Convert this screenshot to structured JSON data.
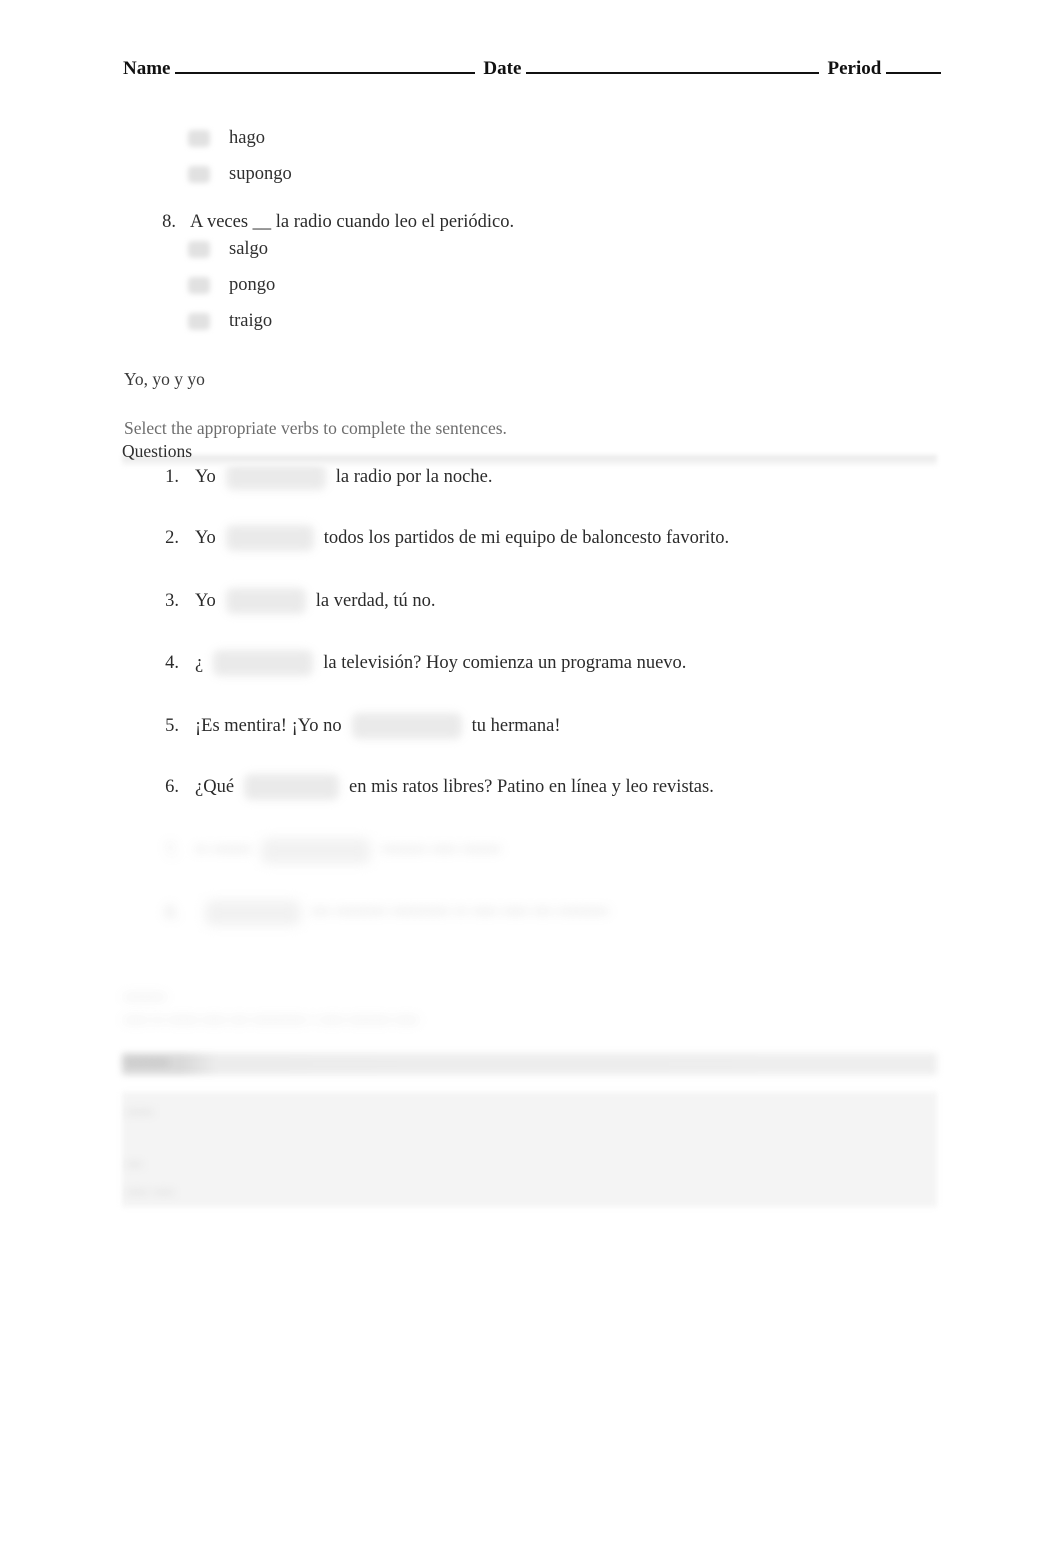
{
  "document": {
    "header": {
      "name_label": "Name",
      "date_label": "Date",
      "period_label": "Period"
    },
    "multiple_choice": {
      "trailing_options": [
        {
          "label": "hago"
        },
        {
          "label": "supongo"
        }
      ],
      "question": {
        "number": "8.",
        "stem": "A veces __ la radio cuando leo el periódico.",
        "options": [
          {
            "label": "salgo"
          },
          {
            "label": "pongo"
          },
          {
            "label": "traigo"
          }
        ]
      }
    },
    "section": {
      "title": "Yo, yo y yo",
      "instructions": "Select the appropriate verbs to complete the sentences.",
      "questions_label": "Questions"
    },
    "fill_in_questions": [
      {
        "number": "1.",
        "pre": "Yo",
        "blank_width": "100",
        "post": "la radio por la noche."
      },
      {
        "number": "2.",
        "pre": "Yo",
        "blank_width": "88",
        "post": "todos los partidos de mi equipo de baloncesto favorito."
      },
      {
        "number": "3.",
        "pre": "Yo",
        "blank_width": "80",
        "post": "la verdad, tú no."
      },
      {
        "number": "4.",
        "pre": "¿",
        "blank_width": "100",
        "post": "la televisión? Hoy comienza un programa nuevo."
      },
      {
        "number": "5.",
        "pre": "¡Es mentira! ¡Yo no",
        "blank_width": "110",
        "post": "tu hermana!"
      },
      {
        "number": "6.",
        "pre": "¿Qué",
        "blank_width": "95",
        "post": "en mis ratos libres? Patino en línea y leo revistas."
      }
    ],
    "obscured_questions": [
      {
        "number": "7.",
        "pre": "•• ••••••",
        "blank_width": "110",
        "post": "••••••• •••• ••••••"
      },
      {
        "number": "8.",
        "pre": "",
        "blank_width": "96",
        "post": "••• •••••••• ••••••••• •• •••• •••• ••• ••••••••"
      }
    ],
    "obscured_footer": {
      "heading": "•••••••",
      "line": "•••• •• ••••• •••• ••• ••••••••• • •••• ••••••• ••••"
    },
    "answers_section": {
      "bar_label": "••••••••",
      "panel_heading": "•••••",
      "panel_line_1": "•••",
      "panel_line_2": "•••• ••••"
    },
    "colors": {
      "page_background": "#ffffff",
      "body_text": "#2b2b2b",
      "muted_text": "#6d6d6d",
      "blank_fill": "#e9e9e9",
      "panel_fill": "#f4f4f4",
      "bar_fill": "#d8d8d8"
    }
  }
}
